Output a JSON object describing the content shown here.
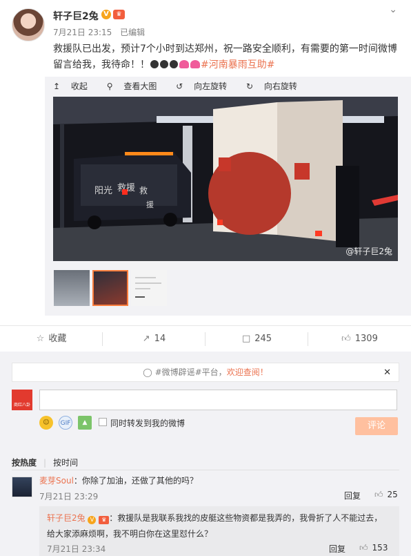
{
  "post": {
    "author": "轩子巨2兔",
    "verified_badge": "V",
    "vip_badge": "♛",
    "time": "7月21日 23:15",
    "edited": "已编辑",
    "text_main": "救援队已出发，预计7个小时到达郑州，祝一路安全顺利，有需要的第一时间微博留言给我，我待命！！",
    "topic": "#河南暴雨互助#",
    "emoji_names": [
      "sun-emoji",
      "sun-emoji",
      "sun-emoji",
      "heart-emoji",
      "heart-emoji"
    ]
  },
  "image_toolbar": {
    "collapse": "收起",
    "view_large": "查看大图",
    "rotate_left": "向左旋转",
    "rotate_right": "向右旋转"
  },
  "photo": {
    "watermark": "@轩子巨2兔",
    "van_text_1": "阳光",
    "van_text_2": "救援",
    "van_text_3": "救",
    "van_text_4": "援"
  },
  "actions": {
    "favorite": "收藏",
    "repost_count": "14",
    "comment_count": "245",
    "like_count": "1309"
  },
  "comment_box": {
    "notice_prefix": "#微博辟谣#平台，",
    "notice_highlight": "欢迎查阅！",
    "logo_text": "商红八卦",
    "input_value": "",
    "repost_label": "同时转发到我的微博",
    "submit": "评论"
  },
  "sort": {
    "hot": "按热度",
    "time": "按时间"
  },
  "comments": [
    {
      "name": "麦芽Soul",
      "text": "：你除了加油，还做了其他的吗？",
      "time": "7月21日 23:29",
      "reply": "回复",
      "likes": "25"
    }
  ],
  "sub_comment": {
    "name": "轩子巨2兔",
    "text_1": "：救援队是我联系我找的皮艇这些物资都是我弄的，我骨折了人不能过去，",
    "text_2": "给大家添麻烦啊，我不明白你在这里怼什么？",
    "time": "7月21日 23:34",
    "reply": "回复",
    "likes": "153"
  },
  "colors": {
    "accent_orange": "#eb7350",
    "submit_disabled": "#ffc09f",
    "panel_bg": "#f2f2f5",
    "brand_red": "#e23a2e"
  }
}
